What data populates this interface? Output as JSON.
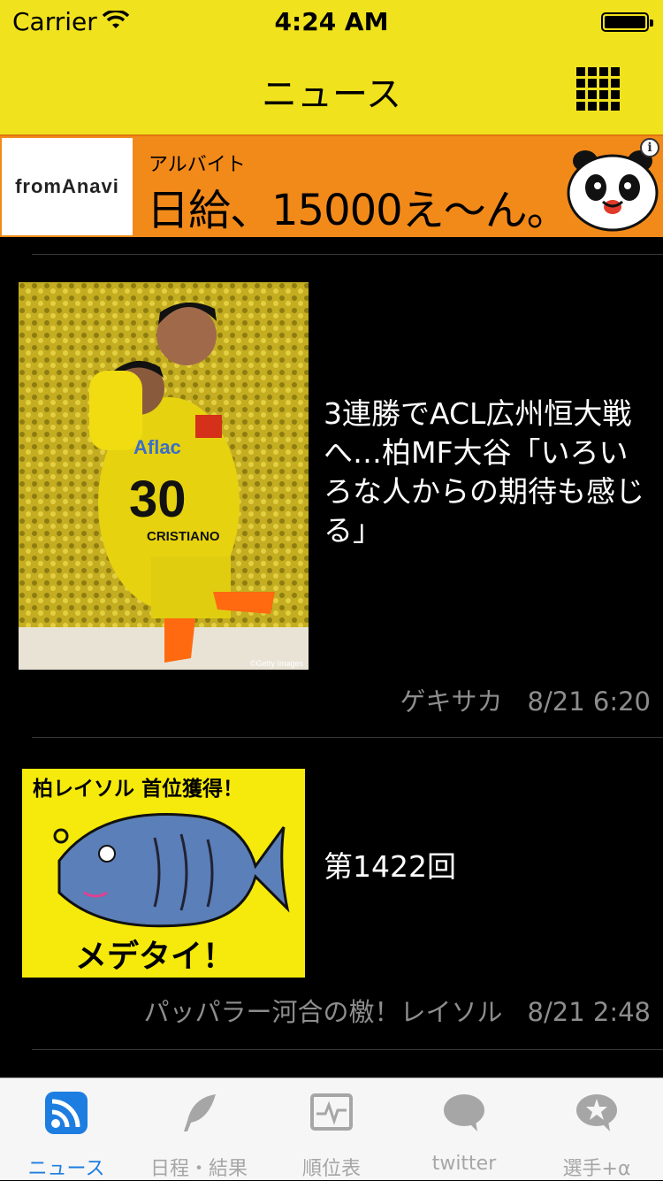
{
  "status_bar": {
    "carrier": "Carrier",
    "time": "4:24 AM"
  },
  "nav": {
    "title": "ニュース",
    "menu_icon": "grid-menu-icon"
  },
  "ad": {
    "logo": "fromAnavi",
    "small_text": "アルバイト",
    "big_text": "日給、15000え〜ん。",
    "info": "i"
  },
  "news": [
    {
      "title": "3連勝でACL広州恒大戦へ…柏MF大谷「いろいろな人からの期待も感じる」",
      "source": "ゲキサカ",
      "date": "8/21 6:20",
      "image_credit": "©Getty Images",
      "jersey_number": "30",
      "jersey_name": "CRISTIANO",
      "sponsor": "Aflac"
    },
    {
      "title": "第1422回",
      "source": "パッパラー河合の檄！レイソル",
      "date": "8/21 2:48",
      "image_top": "柏レイソル 首位獲得！",
      "image_bottom": "メデタイ！"
    }
  ],
  "tabs": [
    {
      "label": "ニュース",
      "icon": "rss-icon",
      "active": true
    },
    {
      "label": "日程・結果",
      "icon": "feather-icon",
      "active": false
    },
    {
      "label": "順位表",
      "icon": "chart-monitor-icon",
      "active": false
    },
    {
      "label": "twitter",
      "icon": "speech-bubble-icon",
      "active": false
    },
    {
      "label": "選手+α",
      "icon": "star-bubble-icon",
      "active": false
    }
  ],
  "colors": {
    "header": "#f0e21d",
    "ad_bg": "#f28a1a",
    "active_tab": "#1e7de0",
    "inactive_tab": "#a6a6a6"
  }
}
